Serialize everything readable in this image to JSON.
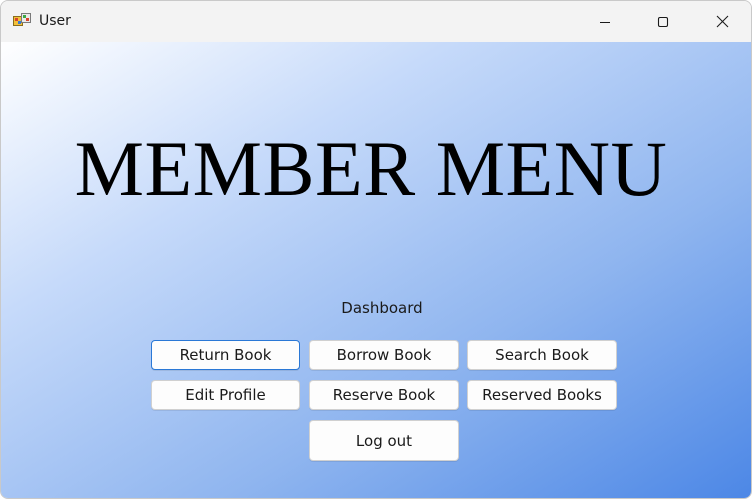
{
  "window": {
    "title": "User",
    "minimize_icon": "minimize-icon",
    "maximize_icon": "maximize-icon",
    "close_icon": "close-icon"
  },
  "main": {
    "heading": "MEMBER MENU",
    "dashboard_label": "Dashboard"
  },
  "buttons": {
    "return_book": "Return Book",
    "borrow_book": "Borrow Book",
    "search_book": "Search Book",
    "edit_profile": "Edit Profile",
    "reserve_book": "Reserve Book",
    "reserved_books": "Reserved Books",
    "log_out": "Log out"
  },
  "colors": {
    "accent_focus": "#2a78d6",
    "gradient_start": "#ffffff",
    "gradient_end": "#4c87e6"
  }
}
